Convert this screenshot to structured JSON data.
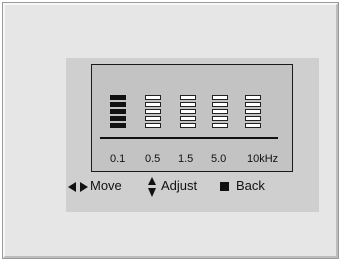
{
  "equalizer": {
    "bands": [
      {
        "label": "0.1",
        "level": 5,
        "max": 5
      },
      {
        "label": "0.5",
        "level": 0,
        "max": 5
      },
      {
        "label": "1.5",
        "level": 0,
        "max": 5
      },
      {
        "label": "5.0",
        "level": 0,
        "max": 5
      },
      {
        "label": "10kHz",
        "level": 0,
        "max": 5
      }
    ]
  },
  "help": {
    "move_label": "Move",
    "adjust_label": "Adjust",
    "back_label": "Back"
  },
  "icons": {
    "left": "left-arrow-icon",
    "right": "right-arrow-icon",
    "updown": "up-down-arrow-icon",
    "stop": "stop-icon"
  }
}
